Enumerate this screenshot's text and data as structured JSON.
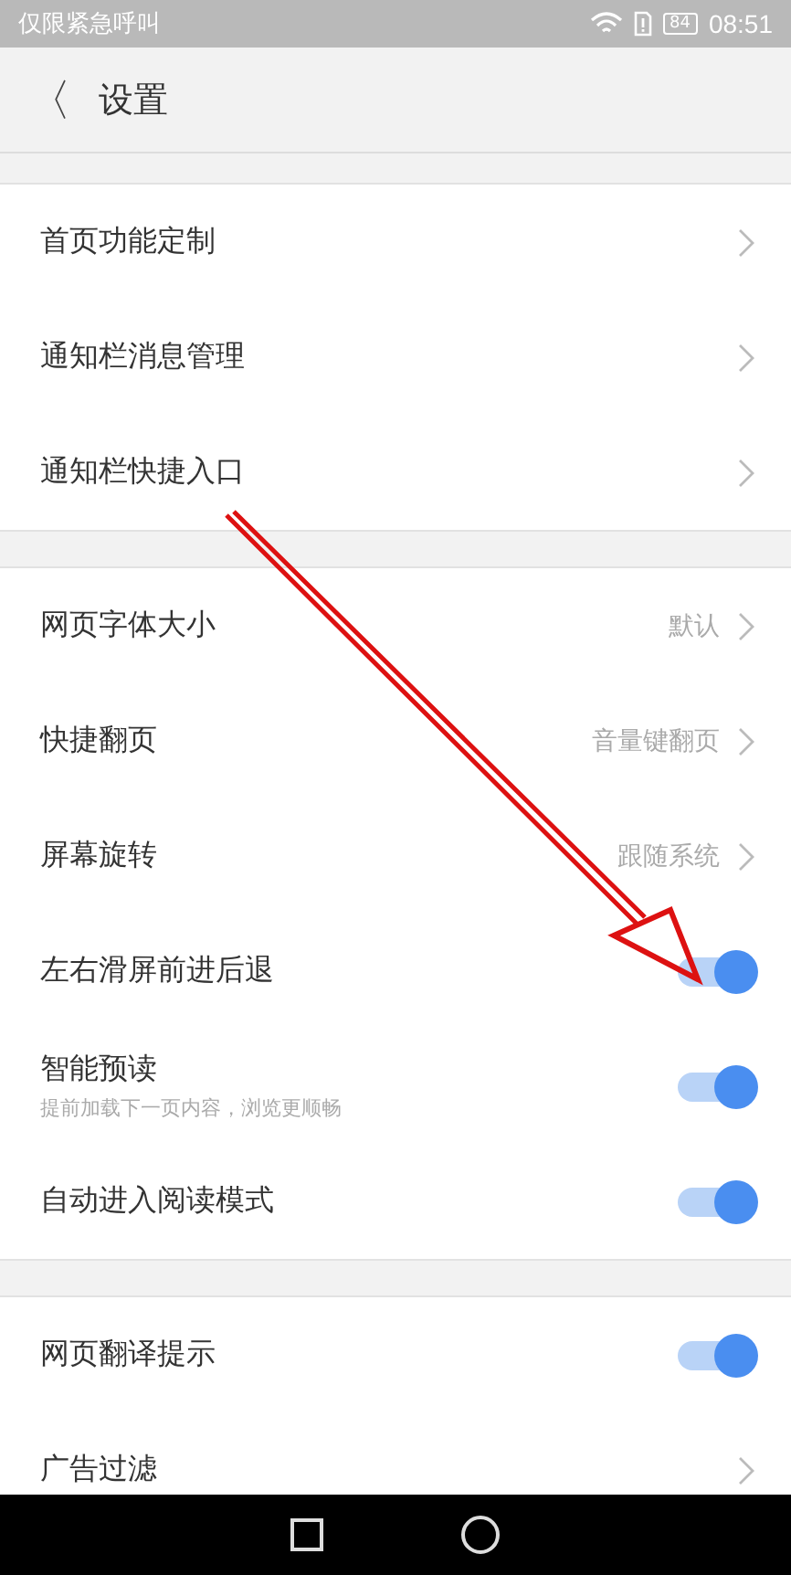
{
  "status_bar": {
    "carrier": "仅限紧急呼叫",
    "battery": "84",
    "time": "08:51"
  },
  "header": {
    "back": "〈",
    "title": "设置"
  },
  "groups": [
    {
      "rows": [
        {
          "kind": "link",
          "label": "首页功能定制"
        },
        {
          "kind": "link",
          "label": "通知栏消息管理"
        },
        {
          "kind": "link",
          "label": "通知栏快捷入口"
        }
      ]
    },
    {
      "rows": [
        {
          "kind": "link",
          "label": "网页字体大小",
          "value": "默认"
        },
        {
          "kind": "link",
          "label": "快捷翻页",
          "value": "音量键翻页"
        },
        {
          "kind": "link",
          "label": "屏幕旋转",
          "value": "跟随系统"
        },
        {
          "kind": "toggle",
          "label": "左右滑屏前进后退",
          "on": true
        },
        {
          "kind": "toggle",
          "label": "智能预读",
          "subtitle": "提前加载下一页内容，浏览更顺畅",
          "on": true
        },
        {
          "kind": "toggle",
          "label": "自动进入阅读模式",
          "on": true
        }
      ]
    },
    {
      "rows": [
        {
          "kind": "toggle",
          "label": "网页翻译提示",
          "on": true
        },
        {
          "kind": "link",
          "label": "广告过滤"
        }
      ]
    }
  ]
}
